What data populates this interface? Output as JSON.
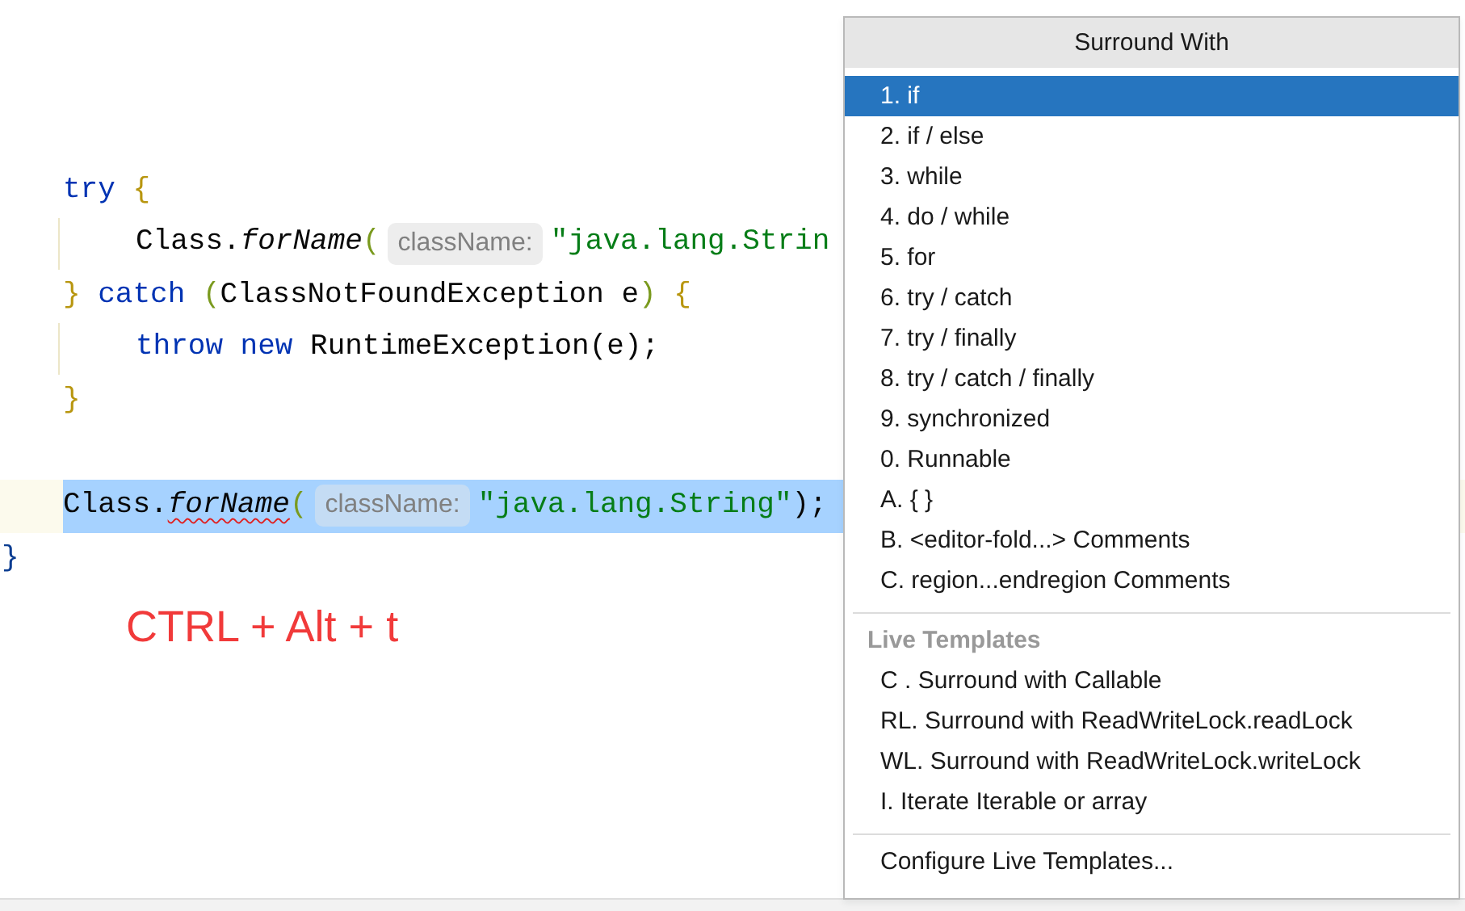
{
  "editor": {
    "blocks": [
      {
        "lines": [
          {
            "selected": false,
            "tokens": [
              {
                "text": "try",
                "kind": "keyword"
              },
              {
                "text": " {",
                "kind": "brace"
              }
            ],
            "children": [
              {
                "selected": false,
                "tokens": [
                  {
                    "text": "Class.",
                    "kind": "plain"
                  },
                  {
                    "text": "forName",
                    "kind": "method"
                  },
                  {
                    "text": "(",
                    "kind": "paren"
                  },
                  {
                    "text": "className:",
                    "kind": "hint"
                  },
                  {
                    "text": "\"java.lang.Strin",
                    "kind": "string"
                  }
                ]
              }
            ]
          },
          {
            "selected": false,
            "tokens": [
              {
                "text": "}",
                "kind": "brace"
              },
              {
                "text": " catch ",
                "kind": "keyword"
              },
              {
                "text": "(",
                "kind": "paren"
              },
              {
                "text": "ClassNotFoundException e",
                "kind": "plain"
              },
              {
                "text": ")",
                "kind": "paren"
              },
              {
                "text": " {",
                "kind": "brace"
              }
            ],
            "children": [
              {
                "selected": false,
                "tokens": [
                  {
                    "text": "throw new ",
                    "kind": "keyword"
                  },
                  {
                    "text": "RuntimeException(e);",
                    "kind": "plain"
                  }
                ]
              }
            ]
          },
          {
            "selected": false,
            "tokens": [
              {
                "text": "}",
                "kind": "brace"
              }
            ]
          }
        ]
      },
      {
        "lines": [
          {
            "selected": true,
            "tokens": [
              {
                "text": "Class.",
                "kind": "plain"
              },
              {
                "text": "forName",
                "kind": "method",
                "error": true
              },
              {
                "text": "(",
                "kind": "paren"
              },
              {
                "text": "className:",
                "kind": "hint"
              },
              {
                "text": "\"java.lang.String\"",
                "kind": "string"
              },
              {
                "text": ");",
                "kind": "plain"
              }
            ]
          }
        ]
      }
    ],
    "closing_brace": "}"
  },
  "annotation": "CTRL + Alt + t",
  "popup": {
    "title": "Surround With",
    "sections": [
      {
        "items": [
          {
            "label": "1. if",
            "selected": true
          },
          {
            "label": "2. if / else",
            "selected": false
          },
          {
            "label": "3. while",
            "selected": false
          },
          {
            "label": "4. do / while",
            "selected": false
          },
          {
            "label": "5. for",
            "selected": false
          },
          {
            "label": "6. try / catch",
            "selected": false
          },
          {
            "label": "7. try / finally",
            "selected": false
          },
          {
            "label": "8. try / catch / finally",
            "selected": false
          },
          {
            "label": "9. synchronized",
            "selected": false
          },
          {
            "label": "0. Runnable",
            "selected": false
          },
          {
            "label": "A. { }",
            "selected": false
          },
          {
            "label": "B. <editor-fold...> Comments",
            "selected": false
          },
          {
            "label": "C. region...endregion Comments",
            "selected": false
          }
        ]
      },
      {
        "heading": "Live Templates",
        "items": [
          {
            "label": "C . Surround with Callable",
            "selected": false
          },
          {
            "label": "RL. Surround with ReadWriteLock.readLock",
            "selected": false
          },
          {
            "label": "WL. Surround with ReadWriteLock.writeLock",
            "selected": false
          },
          {
            "label": "I. Iterate Iterable or array",
            "selected": false
          }
        ]
      },
      {
        "items": [
          {
            "label": "Configure Live Templates...",
            "selected": false
          }
        ]
      }
    ]
  }
}
